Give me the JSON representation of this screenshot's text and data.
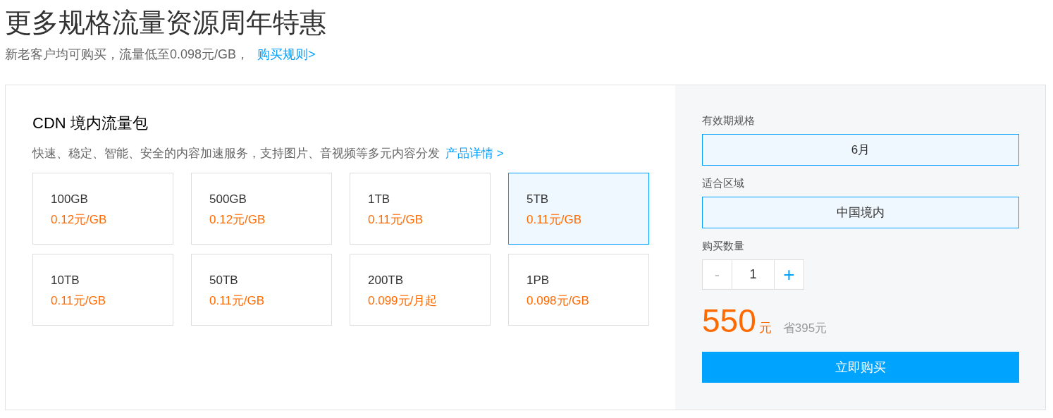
{
  "header": {
    "title": "更多规格流量资源周年特惠",
    "subtitle": "新老客户均可购买，流量低至0.098元/GB，",
    "rules_link": "购买规则>"
  },
  "product": {
    "title": "CDN 境内流量包",
    "description": "快速、稳定、智能、安全的内容加速服务，支持图片、音视频等多元内容分发",
    "details_link": "产品详情 >",
    "packages": [
      {
        "size": "100GB",
        "price": "0.12元/GB",
        "selected": false
      },
      {
        "size": "500GB",
        "price": "0.12元/GB",
        "selected": false
      },
      {
        "size": "1TB",
        "price": "0.11元/GB",
        "selected": false
      },
      {
        "size": "5TB",
        "price": "0.11元/GB",
        "selected": true
      },
      {
        "size": "10TB",
        "price": "0.11元/GB",
        "selected": false
      },
      {
        "size": "50TB",
        "price": "0.11元/GB",
        "selected": false
      },
      {
        "size": "200TB",
        "price": "0.099元/月起",
        "selected": false
      },
      {
        "size": "1PB",
        "price": "0.098元/GB",
        "selected": false
      }
    ]
  },
  "order": {
    "duration_label": "有效期规格",
    "duration": "6月",
    "region_label": "适合区域",
    "region": "中国境内",
    "quantity_label": "购买数量",
    "decrement": "-",
    "quantity": "1",
    "increment": "+",
    "price": "550",
    "currency": "元",
    "savings": "省395元",
    "buy_button": "立即购买"
  }
}
